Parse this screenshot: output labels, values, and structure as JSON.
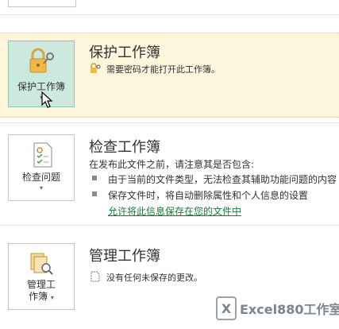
{
  "protect": {
    "tile_label": "保护工作簿",
    "title": "保护工作簿",
    "description": "需要密码才能打开此工作簿。"
  },
  "inspect": {
    "tile_label": "检查问题",
    "title": "检查工作簿",
    "intro": "在发布此文件之前，请注意其是否包含:",
    "bullets": [
      "由于当前的文件类型，无法检查其辅助功能问题的内容",
      "保存文件时，将自动删除属性和个人信息的设置"
    ],
    "link": "允许将此信息保存在您的文件中"
  },
  "manage": {
    "tile_label_line1": "管理工",
    "tile_label_line2": "作簿",
    "title": "管理工作簿",
    "description": "没有任何未保存的更改。"
  },
  "watermark": {
    "logo_letter": "X",
    "text": "Excel880工作室"
  },
  "colors": {
    "highlight_bg": "#fdf6dc",
    "active_tile_bg": "#cce9dd",
    "link": "#1a7a3a"
  }
}
